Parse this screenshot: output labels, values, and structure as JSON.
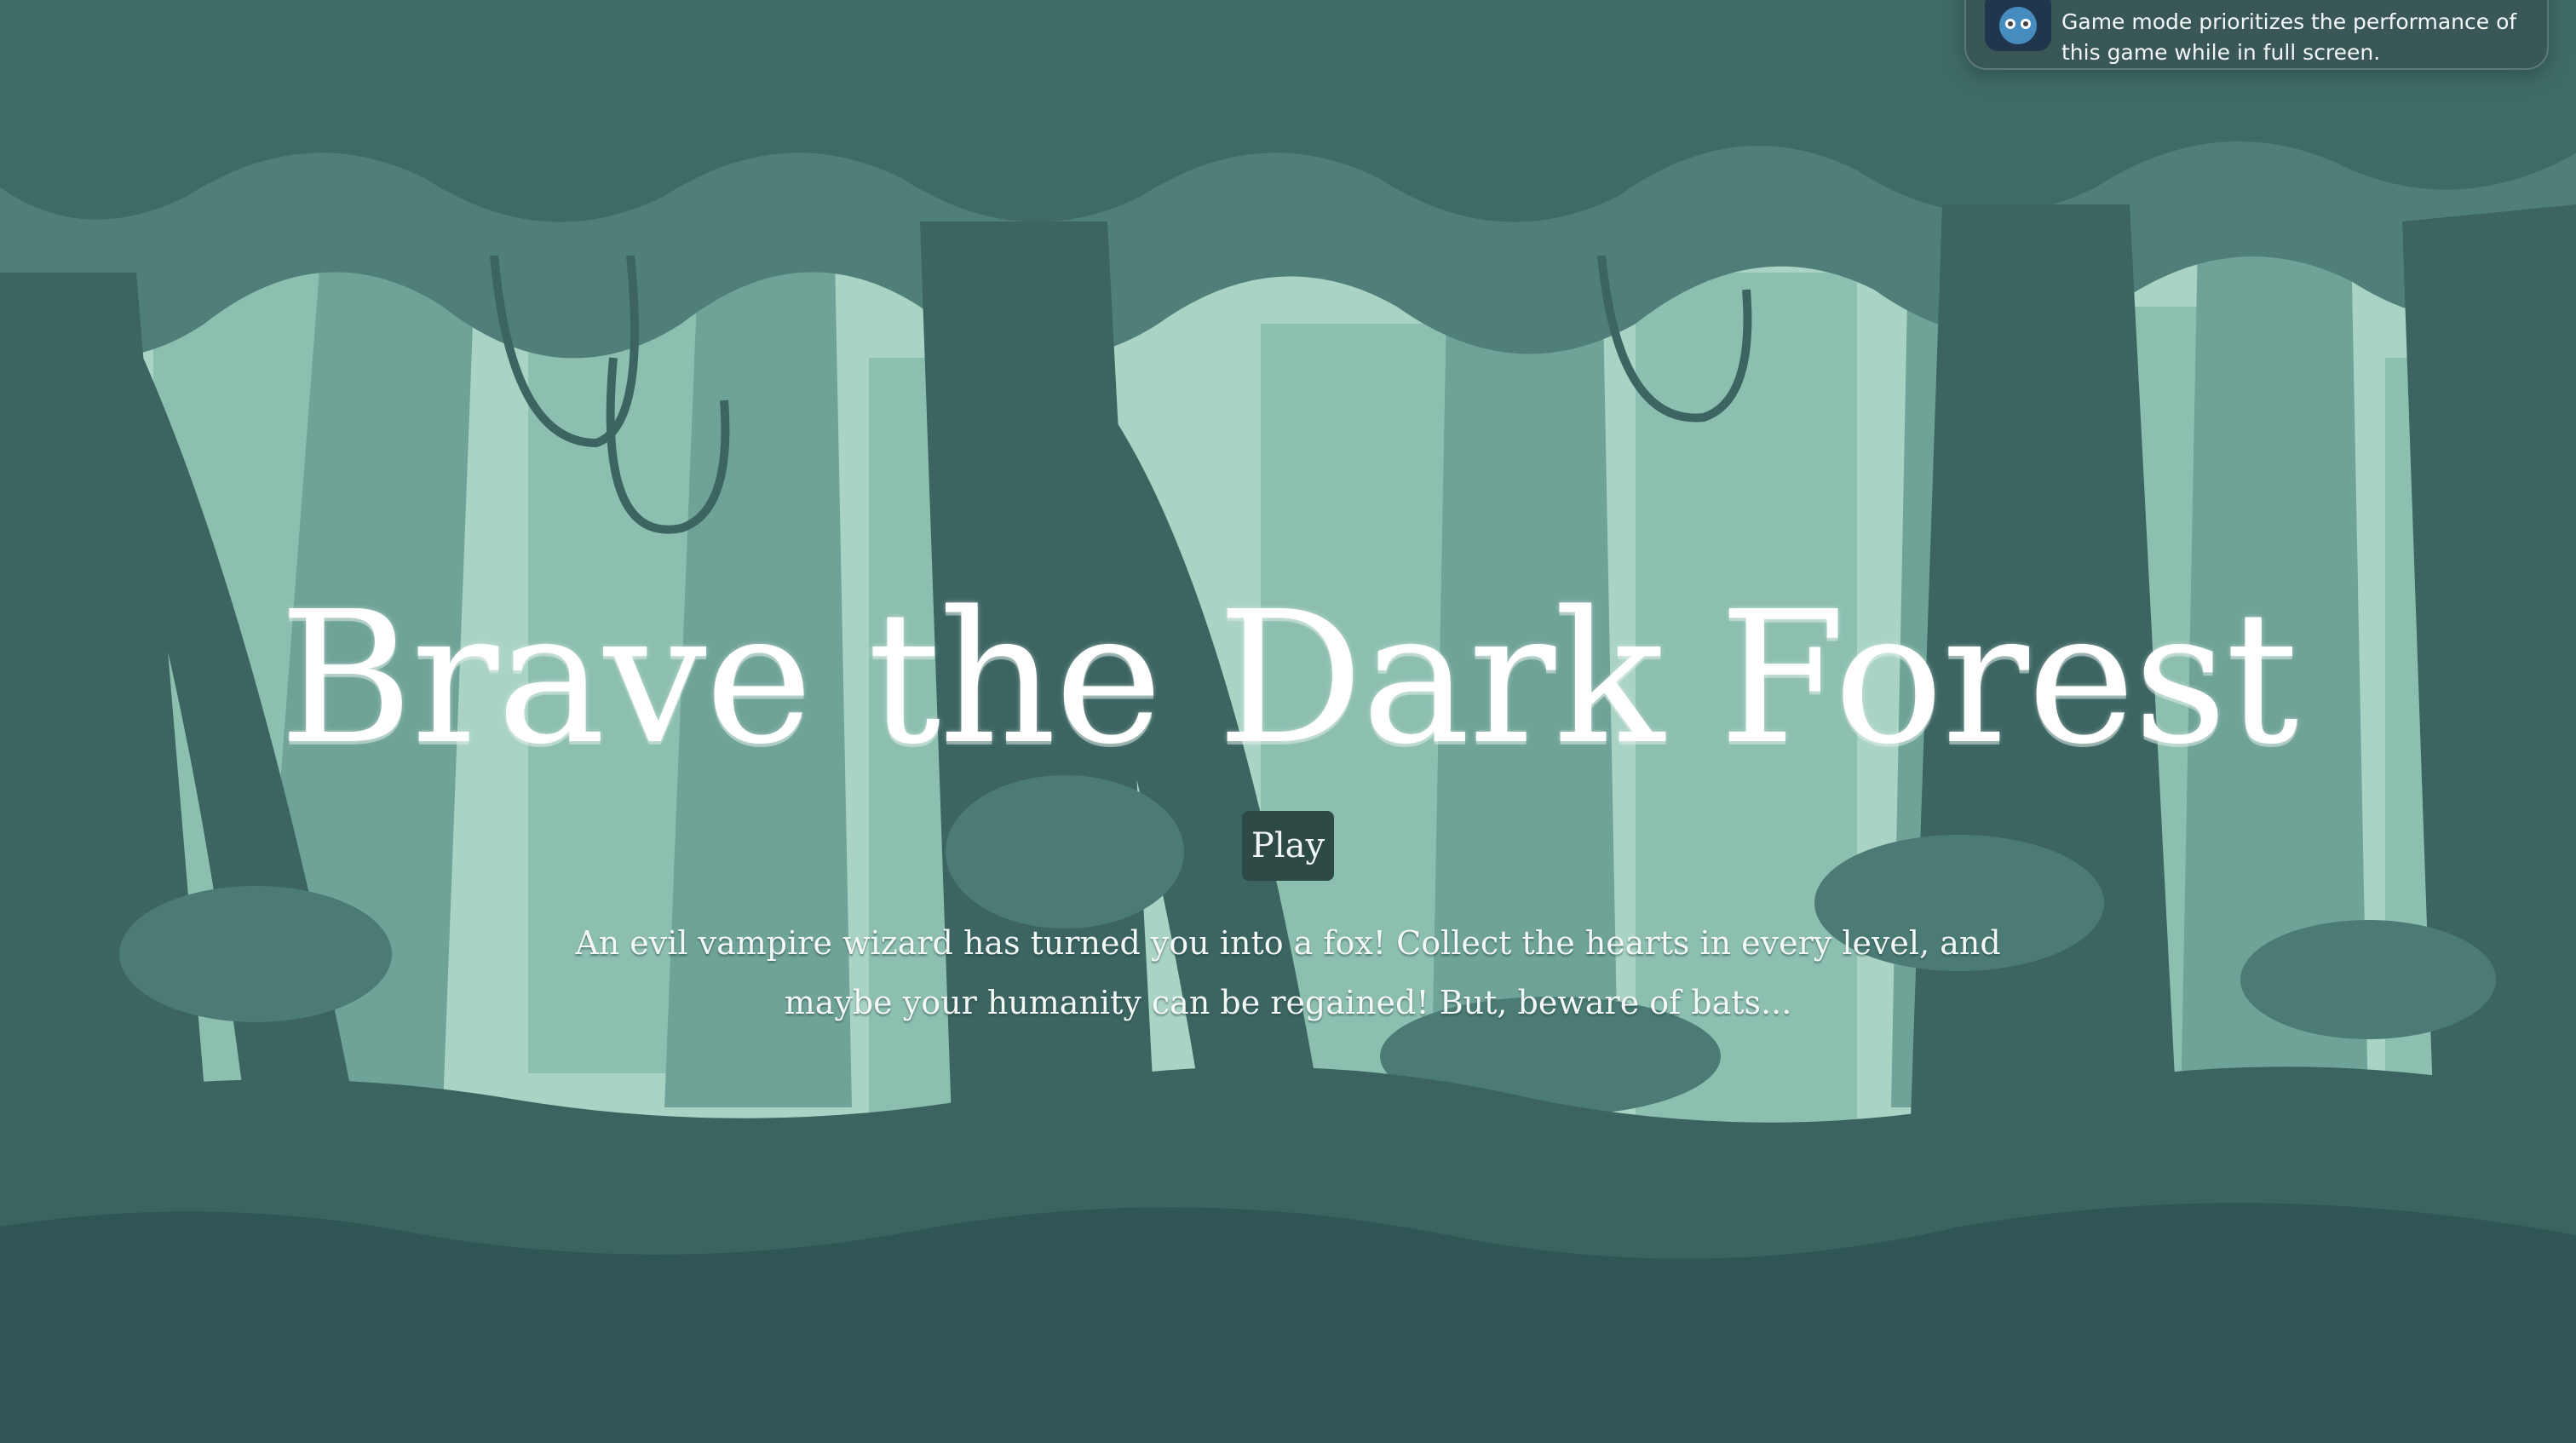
{
  "game": {
    "title": "Brave the Dark Forest",
    "play_label": "Play",
    "description": "An evil vampire wizard has turned you into a fox! Collect the hearts in every level, and maybe your humanity can be regained! But, beware of bats..."
  },
  "notification": {
    "message": "Game mode prioritizes the performance of this game while in full screen.",
    "icon": "godot-icon"
  },
  "colors": {
    "sky_light": "#b5dccd",
    "mid_tree": "#5e9488",
    "dark_tree": "#3c6562",
    "ground": "#2f5554",
    "button_bg": "#2d4a47",
    "text": "#ffffff"
  }
}
